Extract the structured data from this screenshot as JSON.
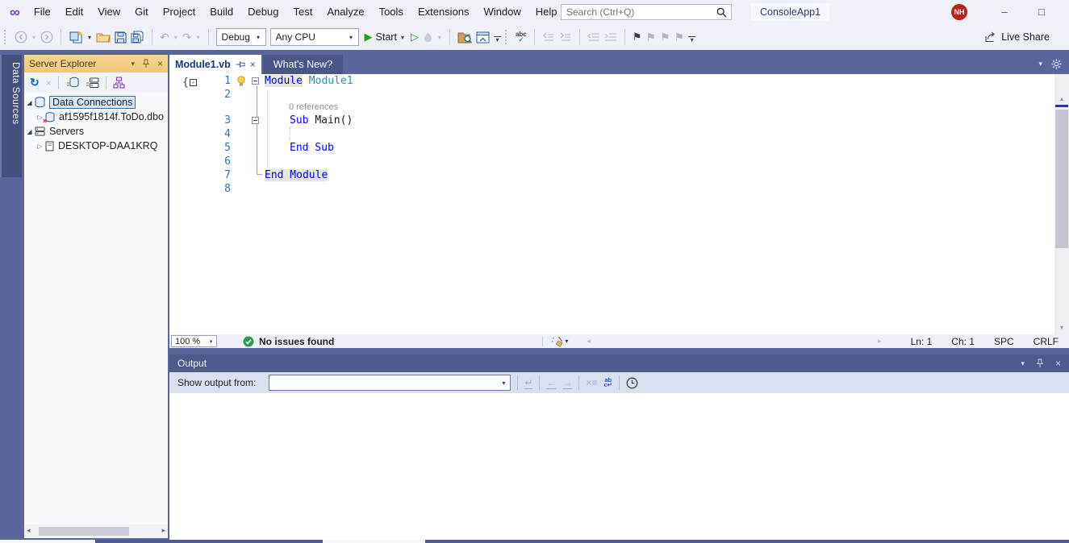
{
  "titlebar": {
    "menus": [
      "File",
      "Edit",
      "View",
      "Git",
      "Project",
      "Build",
      "Debug",
      "Test",
      "Analyze",
      "Tools",
      "Extensions",
      "Window",
      "Help"
    ],
    "search": {
      "placeholder": "Search (Ctrl+Q)"
    },
    "solution_badge": "ConsoleApp1",
    "avatar_initials": "NH",
    "window": {
      "minimize": "–",
      "maximize": "□"
    }
  },
  "toolbar": {
    "configuration": "Debug",
    "platform": "Any CPU",
    "start_label": "Start",
    "live_share_label": "Live Share"
  },
  "server_explorer": {
    "vertical_tab": "Data Sources",
    "title": "Server Explorer",
    "tree": {
      "data_connections": "Data Connections",
      "database": "af1595f1814f.ToDo.dbo",
      "servers": "Servers",
      "machine": "DESKTOP-DAA1KRQ"
    }
  },
  "editor": {
    "tabs": {
      "active": "Module1.vb",
      "inactive": "What's New?"
    },
    "line_numbers": [
      "1",
      "2",
      "3",
      "4",
      "5",
      "6",
      "7",
      "8"
    ],
    "codelens": "0 references",
    "code": {
      "l1": {
        "kw": "Module",
        "id": "Module1"
      },
      "l3": {
        "kw": "Sub",
        "id": "Main()"
      },
      "l5": {
        "kw": "End Sub"
      },
      "l7": {
        "kw": "End Module"
      }
    },
    "status": {
      "zoom": "100 %",
      "issues": "No issues found",
      "ln": "Ln: 1",
      "ch": "Ch: 1",
      "spc": "SPC",
      "eol": "CRLF"
    }
  },
  "output": {
    "title": "Output",
    "show_from_label": "Show output from:"
  },
  "glyphs": {
    "logo": "∞",
    "chevron_down": "▾",
    "chevron_right": "▷",
    "tri_expanded": "◢",
    "close": "×",
    "refresh": "↻",
    "undo": "↶",
    "redo": "↷",
    "flag": "⚑",
    "scroll_left": "◂",
    "scroll_right": "▸",
    "scroll_up": "▴",
    "scroll_down": "▾",
    "arrow_ne": "↗",
    "return": "↵",
    "lines": "≡",
    "left_arrow": "←",
    "right_arrow": "→"
  },
  "colors": {
    "main_background": "#5A659B",
    "active_toolwindow_title": "#F2C875",
    "keyword_blue": "#0000FF",
    "type_teal": "#2B91AF",
    "run_green": "#19A319",
    "avatar_red": "#BE2119"
  }
}
